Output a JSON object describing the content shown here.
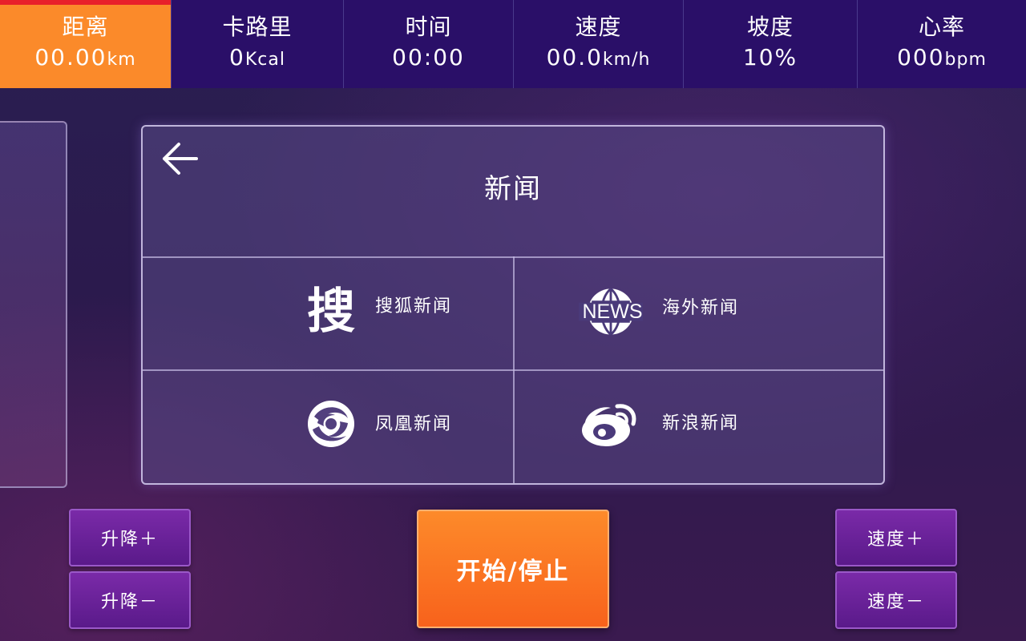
{
  "stats": [
    {
      "label": "距离",
      "value": "00.00",
      "unit": "km",
      "active": true
    },
    {
      "label": "卡路里",
      "value": "0",
      "unit": "Kcal",
      "active": false
    },
    {
      "label": "时间",
      "value": "00:00",
      "unit": "",
      "active": false
    },
    {
      "label": "速度",
      "value": "00.0",
      "unit": "km/h",
      "active": false
    },
    {
      "label": "坡度",
      "value": "10%",
      "unit": "",
      "active": false
    },
    {
      "label": "心率",
      "value": "000",
      "unit": "bpm",
      "active": false
    }
  ],
  "news_panel": {
    "title": "新闻",
    "back_icon": "arrow-left-icon",
    "items": [
      {
        "label": "搜狐新闻",
        "icon": "sohu-icon",
        "icon_text": "搜"
      },
      {
        "label": "海外新闻",
        "icon": "news-globe-icon",
        "icon_text": "NEWS"
      },
      {
        "label": "凤凰新闻",
        "icon": "phoenix-icon"
      },
      {
        "label": "新浪新闻",
        "icon": "weibo-icon"
      }
    ]
  },
  "controls": {
    "incline_up": "升降＋",
    "incline_down": "升降－",
    "start_stop": "开始/停止",
    "speed_up": "速度＋",
    "speed_down": "速度－"
  },
  "colors": {
    "active_stat": "#fb8a2a",
    "stats_bar": "#2a0f68",
    "start_button": "#f8621c",
    "purple_button": "#6a209a"
  }
}
